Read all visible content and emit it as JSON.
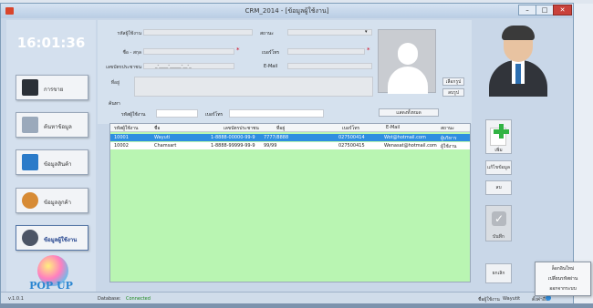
{
  "window": {
    "title": "CRM_2014 - [ข้อมูลผู้ใช้งาน]"
  },
  "window_controls": {
    "minimize": "–",
    "maximize": "□",
    "close": "✕"
  },
  "sidebar": {
    "clock": "16:01:36",
    "items": [
      {
        "label": "การขาย",
        "icon": "register-icon"
      },
      {
        "label": "ค้นหาข้อมูล",
        "icon": "search-icon"
      },
      {
        "label": "ข้อมูลสินค้า",
        "icon": "computer-icon"
      },
      {
        "label": "ข้อมูลลูกค้า",
        "icon": "customers-icon"
      },
      {
        "label": "ข้อมูลผู้ใช้งาน",
        "icon": "user-icon"
      }
    ],
    "logo_text": "POP UP"
  },
  "form": {
    "user_id_label": "รหัสผู้ใช้งาน",
    "user_id_value": "",
    "status_label": "สถานะ",
    "status_value": "",
    "name_label": "ชื่อ - สกุล",
    "name_value": "",
    "phone_label": "เบอร์โทร",
    "phone_value": "",
    "citizen_id_label": "เลขบัตรประชาชน",
    "citizen_id_value": "_-____-_____-__-_",
    "email_label": "E-Mail",
    "email_value": "",
    "address_label": "ที่อยู่",
    "address_value": "",
    "search_label": "ค้นหา",
    "search_user_id_label": "รหัสผู้ใช้งาน",
    "search_user_id_value": "",
    "search_phone_label": "เบอร์โทร",
    "search_phone_value": "",
    "required_mark": "*",
    "browse_button": "เลือกรูป",
    "delete_photo_button": "ลบรูป",
    "show_all_button": "แสดงทั้งหมด"
  },
  "table": {
    "columns": [
      "รหัสผู้ใช้งาน",
      "ชื่อ",
      "เลขบัตรประชาชน",
      "ที่อยู่",
      "เบอร์โทร",
      "E-Mail",
      "สถานะ"
    ],
    "rows": [
      {
        "id": "10001",
        "name": "Wayuti",
        "citizen": "1-8888-00000-99-9",
        "address": "7777/8888",
        "phone": "027500414",
        "email": "Wot@hotmail.com",
        "status": "ผู้บริหาร"
      },
      {
        "id": "10002",
        "name": "Chamsart",
        "citizen": "1-8888-99999-99-9",
        "address": "99/99",
        "phone": "027500415",
        "email": "Wenasat@hotmail.com",
        "status": "ผู้ใช้งาน"
      }
    ]
  },
  "actions": {
    "add": "เพิ่ม",
    "edit": "แก้ไขข้อมูล",
    "delete": "ลบ",
    "save": "บันทึก",
    "cancel": "ยกเลิก"
  },
  "statusbar": {
    "version": "v.1.0.1",
    "db_label": "Database:",
    "db_value": "Connected",
    "user_label": "ชื่อผู้ใช้งาน",
    "user_value": "Wayutit",
    "settings_label": "ตั้งค่าอื่น"
  },
  "context_menu": {
    "items": [
      "ล็อกอินใหม่",
      "เปลี่ยนรหัสผ่าน",
      "ออกจากระบบ"
    ]
  },
  "colors": {
    "selected_row": "#2f8ee0",
    "grid_background": "#b9f5b2",
    "required": "#d0021b",
    "db_connected": "#1e8a1e"
  }
}
